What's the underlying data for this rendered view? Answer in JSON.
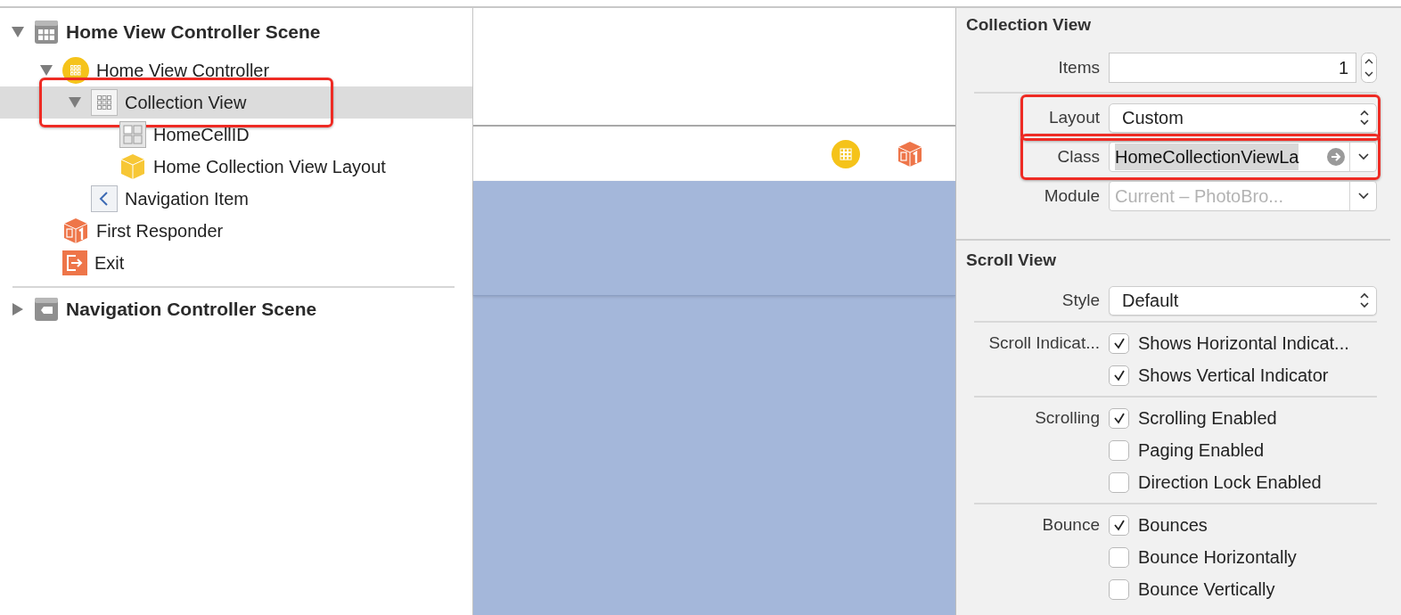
{
  "outline": [
    {
      "label": "Home View Controller Scene",
      "kind": "scene",
      "expanded": true,
      "selected": false,
      "highlighted": false,
      "children": [
        {
          "label": "Home View Controller",
          "kind": "controller",
          "expanded": true,
          "selected": false,
          "highlighted": false,
          "children": [
            {
              "label": "Collection View",
              "kind": "collection",
              "expanded": true,
              "selected": true,
              "highlighted": true,
              "children": [
                {
                  "label": "HomeCellID",
                  "kind": "cell",
                  "selected": false,
                  "highlighted": false
                },
                {
                  "label": "Home Collection View Layout",
                  "kind": "layout",
                  "selected": false,
                  "highlighted": false
                }
              ]
            },
            {
              "label": "Navigation Item",
              "kind": "navitem",
              "selected": false,
              "highlighted": false
            }
          ]
        },
        {
          "label": "First Responder",
          "kind": "responder",
          "selected": false,
          "highlighted": false
        },
        {
          "label": "Exit",
          "kind": "exit",
          "selected": false,
          "highlighted": false
        }
      ]
    },
    {
      "label": "Navigation Controller Scene",
      "kind": "navscene",
      "expanded": false,
      "selected": false,
      "highlighted": false
    }
  ],
  "inspector": [
    {
      "title": "Collection View",
      "groups": [
        {
          "rows": [
            {
              "kind": "stepper",
              "label": "Items",
              "value": "1",
              "highlighted": false
            }
          ]
        },
        {
          "rows": [
            {
              "kind": "popup",
              "label": "Layout",
              "value": "Custom",
              "highlighted": true
            },
            {
              "kind": "combo",
              "label": "Class",
              "value": "HomeCollectionViewLa",
              "text_selected": true,
              "highlighted": true
            },
            {
              "kind": "combo",
              "label": "Module",
              "placeholder": "Current – PhotoBro...",
              "highlighted": false
            }
          ]
        }
      ]
    },
    {
      "title": "Scroll View",
      "groups": [
        {
          "rows": [
            {
              "kind": "popup",
              "label": "Style",
              "value": "Default",
              "highlighted": false
            }
          ]
        },
        {
          "rows": [
            {
              "kind": "checkbox",
              "label": "Scroll Indicat...",
              "text": "Shows Horizontal Indicat...",
              "checked": true
            },
            {
              "kind": "checkbox",
              "text": "Shows Vertical Indicator",
              "checked": true
            }
          ]
        },
        {
          "rows": [
            {
              "kind": "checkbox",
              "label": "Scrolling",
              "text": "Scrolling Enabled",
              "checked": true
            },
            {
              "kind": "checkbox",
              "text": "Paging Enabled",
              "checked": false
            },
            {
              "kind": "checkbox",
              "text": "Direction Lock Enabled",
              "checked": false
            }
          ]
        },
        {
          "rows": [
            {
              "kind": "checkbox",
              "label": "Bounce",
              "text": "Bounces",
              "checked": true
            },
            {
              "kind": "checkbox",
              "text": "Bounce Horizontally",
              "checked": false
            },
            {
              "kind": "checkbox",
              "text": "Bounce Vertically",
              "checked": false
            }
          ]
        }
      ]
    }
  ]
}
